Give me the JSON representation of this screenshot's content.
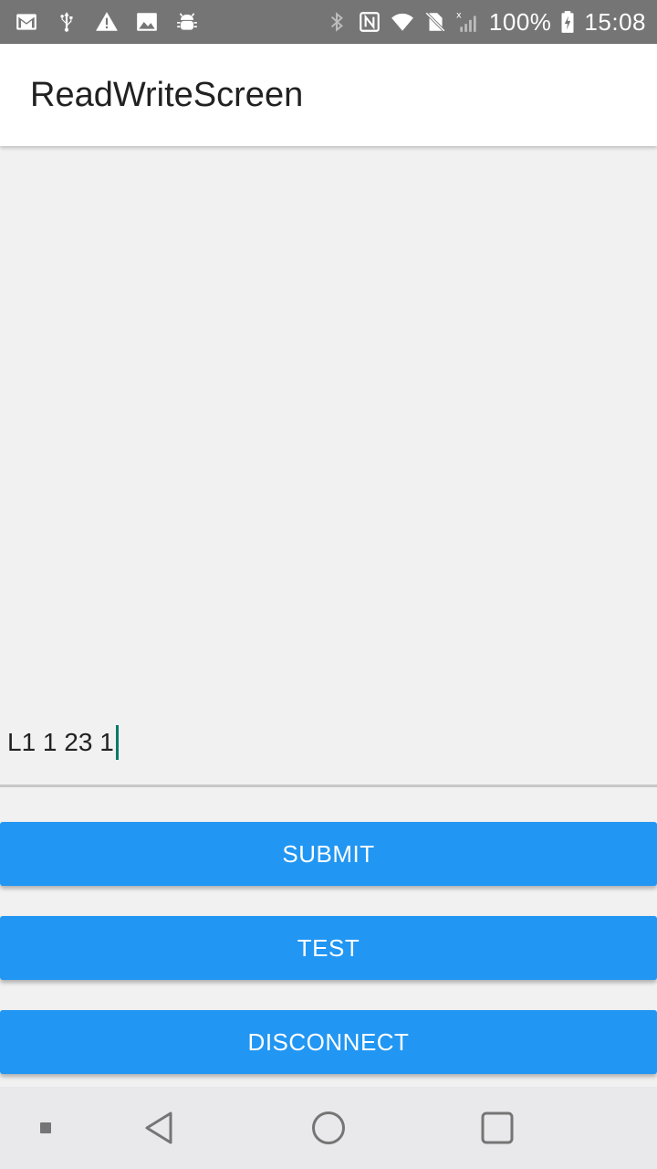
{
  "status_bar": {
    "icons_left": [
      "gmail-icon",
      "usb-icon",
      "warning-icon",
      "image-icon",
      "android-debug-icon"
    ],
    "icons_right": [
      "bluetooth-icon",
      "nfc-icon",
      "wifi-icon",
      "no-sim-icon",
      "signal-icon",
      "battery-charging-icon"
    ],
    "battery": "100%",
    "time": "15:08"
  },
  "app_bar": {
    "title": "ReadWriteScreen"
  },
  "input": {
    "value": "L1 1 23 1"
  },
  "buttons": {
    "submit": "SUBMIT",
    "test": "TEST",
    "disconnect": "DISCONNECT"
  },
  "colors": {
    "status_bar": "#757575",
    "accent": "#2196f3",
    "caret": "#00796b",
    "background": "#f1f1f1"
  },
  "nav_bar": {
    "icons": [
      "keyboard-dot-icon",
      "back-icon",
      "home-icon",
      "recents-icon"
    ]
  }
}
